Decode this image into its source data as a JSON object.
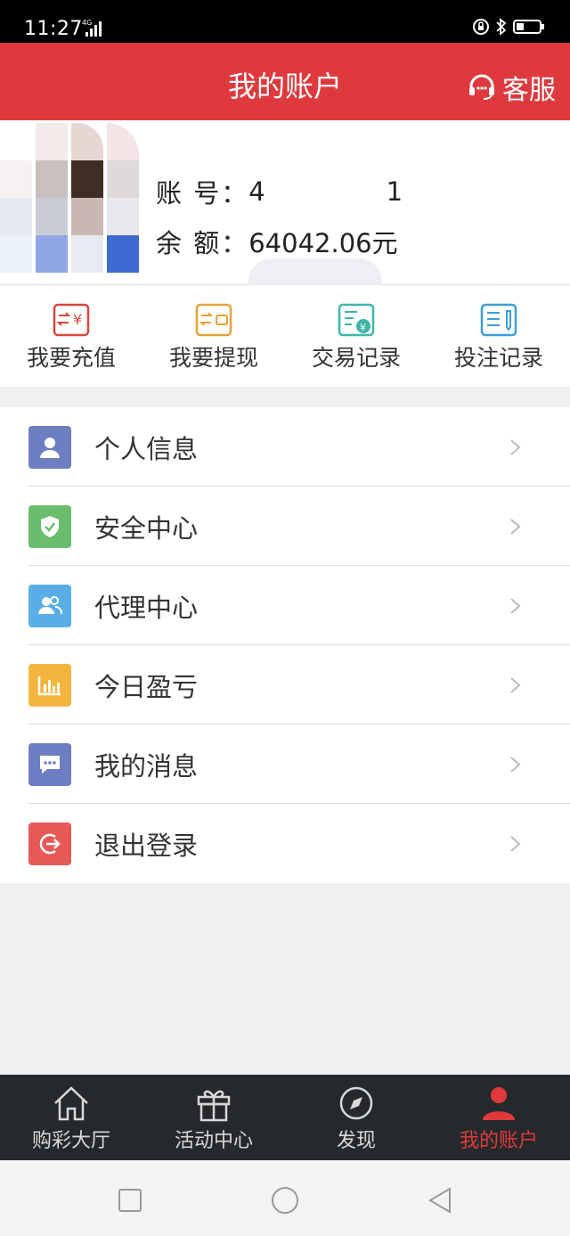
{
  "status_bar": {
    "time": "11:27",
    "network": "4G"
  },
  "header": {
    "title": "我的账户",
    "service_label": "客服"
  },
  "account": {
    "account_label": "账 号：",
    "account_value_start": "4",
    "account_value_end": "1",
    "balance_label": "余 额：",
    "balance_value": "64042.06元"
  },
  "quick_actions": [
    {
      "label": "我要充值",
      "icon": "recharge-icon",
      "color": "#d9473f"
    },
    {
      "label": "我要提现",
      "icon": "withdraw-icon",
      "color": "#e4a234"
    },
    {
      "label": "交易记录",
      "icon": "transaction-record-icon",
      "color": "#3fb6a8"
    },
    {
      "label": "投注记录",
      "icon": "bet-record-icon",
      "color": "#3b9fd6"
    }
  ],
  "menu": [
    {
      "label": "个人信息",
      "icon": "user-icon",
      "color": "#6d7ec2"
    },
    {
      "label": "安全中心",
      "icon": "shield-icon",
      "color": "#6bbd6e"
    },
    {
      "label": "代理中心",
      "icon": "agents-icon",
      "color": "#5aaee6"
    },
    {
      "label": "今日盈亏",
      "icon": "bar-chart-icon",
      "color": "#f2b540"
    },
    {
      "label": "我的消息",
      "icon": "message-icon",
      "color": "#6d7ec2"
    },
    {
      "label": "退出登录",
      "icon": "logout-icon",
      "color": "#e75959"
    }
  ],
  "tabs": [
    {
      "label": "购彩大厅",
      "icon": "home-icon",
      "active": false
    },
    {
      "label": "活动中心",
      "icon": "gift-icon",
      "active": false
    },
    {
      "label": "发现",
      "icon": "compass-icon",
      "active": false
    },
    {
      "label": "我的账户",
      "icon": "person-icon",
      "active": true
    }
  ],
  "colors": {
    "brand_red": "#de3a3e",
    "tab_bar": "#26292c",
    "active_tab": "#e0393c"
  }
}
